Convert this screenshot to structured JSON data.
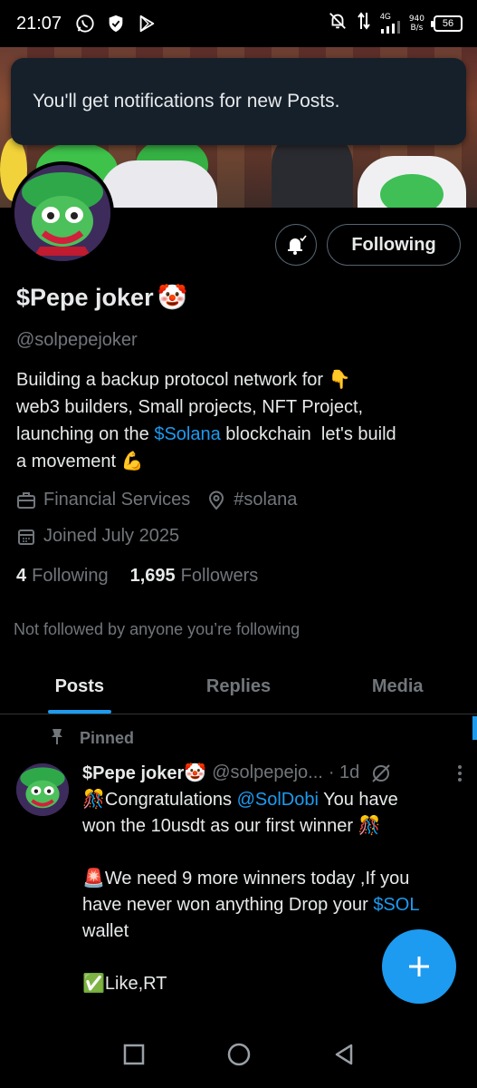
{
  "status_bar": {
    "time": "21:07",
    "network_speed_value": "940",
    "network_speed_unit": "B/s",
    "network_type": "4G",
    "battery": "56"
  },
  "toast": {
    "text": "You'll get notifications for new Posts."
  },
  "profile": {
    "name": "$Pepe joker",
    "name_emoji": "🤡",
    "handle": "@solpepejoker",
    "bio": {
      "line1_pre": "Building a backup protocol network for ",
      "line1_emoji": "👇",
      "line2": "web3 builders, Small projects, NFT Project,",
      "line3_pre": "launching on the ",
      "line3_link": "$Solana",
      "line3_post": " blockchain  let's build",
      "line4_pre": "a movement ",
      "line4_emoji": "💪"
    },
    "category": "Financial Services",
    "location": "#solana",
    "joined": "Joined July 2025",
    "following_count": "4",
    "following_label": "Following",
    "followers_count": "1,695",
    "followers_label": "Followers",
    "not_followed": "Not followed by anyone you’re following"
  },
  "actions": {
    "follow_label": "Following"
  },
  "tabs": [
    {
      "label": "Posts",
      "active": true
    },
    {
      "label": "Replies",
      "active": false
    },
    {
      "label": "Media",
      "active": false
    }
  ],
  "post": {
    "pinned_label": "Pinned",
    "author_name": "$Pepe joker",
    "author_emoji": "🤡",
    "author_handle": "@solpepejo...",
    "time": "· 1d",
    "line1_emoji": "🎊",
    "line1_pre": "Congratulations ",
    "line1_mention": "@SolDobi",
    "line1_post": " You have",
    "line2": "won the 10usdt as our first winner ",
    "line2_emoji": "🎊",
    "line3_emoji": "🚨",
    "line3": "We need 9 more winners today ,If you",
    "line4_pre": "have never won anything Drop your ",
    "line4_link": "$SOL",
    "line5": "wallet",
    "line6_emoji": "✅",
    "line6": "Like,RT"
  },
  "colors": {
    "accent": "#1d9bf0",
    "background": "#000000",
    "secondary_text": "#71767b",
    "toast_bg": "#15202b"
  },
  "icons": {
    "status_left": [
      "whatsapp-icon",
      "shield-icon",
      "play-store-icon"
    ],
    "status_right": [
      "bell-off-icon",
      "data-arrows-icon",
      "signal-icon",
      "battery-icon"
    ],
    "nav": [
      "square-nav-icon",
      "circle-nav-icon",
      "triangle-nav-icon"
    ]
  }
}
